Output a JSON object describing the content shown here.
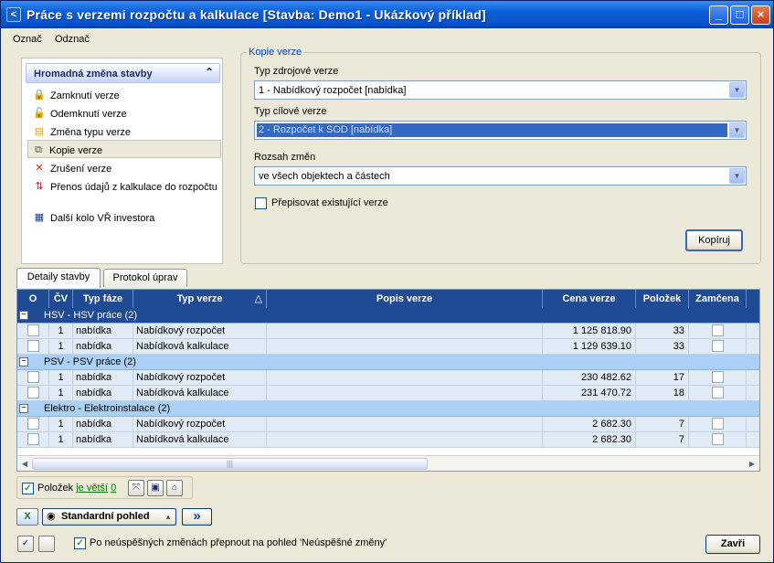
{
  "window": {
    "title": "Práce s verzemi rozpočtu a kalkulace   [Stavba:  Demo1 - Ukázkový příklad]",
    "minimize": "_",
    "maximize": "□",
    "close": "×"
  },
  "menu": [
    "Označ",
    "Odznač"
  ],
  "taskpanel": {
    "header": "Hromadná změna stavby",
    "collapse": "⌃",
    "items": [
      {
        "label": "Zamknutí verze",
        "icon": "lock-icon",
        "glyph": "🔒"
      },
      {
        "label": "Odemknutí verze",
        "icon": "unlock-icon",
        "glyph": "🔓"
      },
      {
        "label": "Změna typu verze",
        "icon": "change-type-icon",
        "glyph": "▤"
      },
      {
        "label": "Kopie verze",
        "icon": "copy-icon",
        "glyph": "⧉"
      },
      {
        "label": "Zrušení verze",
        "icon": "delete-icon",
        "glyph": "✕"
      },
      {
        "label": "Přenos údajů z kalkulace do rozpočtu",
        "icon": "transfer-icon",
        "glyph": "⇅"
      },
      {
        "label": "Další kolo VŘ investora",
        "icon": "next-round-icon",
        "glyph": "▦"
      }
    ]
  },
  "copy": {
    "legend": "Kopie verze",
    "source_label": "Typ zdrojové verze",
    "source_value": "1 - Nabídkový rozpočet [nabídka]",
    "target_label": "Typ cílové verze",
    "target_value": "2 - Rozpočet k SOD [nabídka]",
    "scope_label": "Rozsah změn",
    "scope_value": "ve všech objektech a částech",
    "overwrite_label": "Přepisovat existující verze",
    "copy_button": "Kopíruj",
    "arrow": "▼"
  },
  "tabs": [
    "Detaily stavby",
    "Protokol úprav"
  ],
  "grid": {
    "columns": [
      "O",
      "ČV",
      "Typ fáze",
      "Typ verze",
      "Popis verze",
      "Cena verze",
      "Položek",
      "Zamčena"
    ],
    "sort_glyph": "△",
    "groups": [
      {
        "label": "HSV - HSV práce  (2)",
        "rows": [
          {
            "cv": "1",
            "faze": "nabídka",
            "verze": "Nabídkový rozpočet",
            "popis": "",
            "cena": "1 125 818.90",
            "polozek": "33"
          },
          {
            "cv": "1",
            "faze": "nabídka",
            "verze": "Nabídková kalkulace",
            "popis": "",
            "cena": "1 129 639.10",
            "polozek": "33"
          }
        ]
      },
      {
        "label": "PSV - PSV práce  (2)",
        "rows": [
          {
            "cv": "1",
            "faze": "nabídka",
            "verze": "Nabídkový rozpočet",
            "popis": "",
            "cena": "230 482.62",
            "polozek": "17"
          },
          {
            "cv": "1",
            "faze": "nabídka",
            "verze": "Nabídková kalkulace",
            "popis": "",
            "cena": "231 470.72",
            "polozek": "18"
          }
        ]
      },
      {
        "label": "Elektro - Elektroinstalace  (2)",
        "rows": [
          {
            "cv": "1",
            "faze": "nabídka",
            "verze": "Nabídkový rozpočet",
            "popis": "",
            "cena": "2 682.30",
            "polozek": "7"
          },
          {
            "cv": "1",
            "faze": "nabídka",
            "verze": "Nabídková kalkulace",
            "popis": "",
            "cena": "2 682.30",
            "polozek": "7"
          }
        ]
      }
    ],
    "scroll_left": "◀",
    "scroll_right": "▶",
    "thumb_grip": "|||"
  },
  "filter": {
    "label_prefix": "Položek",
    "link": "je větší",
    "value": "0",
    "btn1": "⤧",
    "btn2": "▣",
    "btn3": "⌂"
  },
  "bottom": {
    "excel": "X",
    "view_label": "Standardní pohled",
    "view_glyph": "◉",
    "view_arrow": "▲",
    "forward": "»",
    "check_all": "✓",
    "switch_label": "Po neúspěšných změnách přepnout na pohled 'Neúspěšné změny'",
    "close_button": "Zavři"
  }
}
